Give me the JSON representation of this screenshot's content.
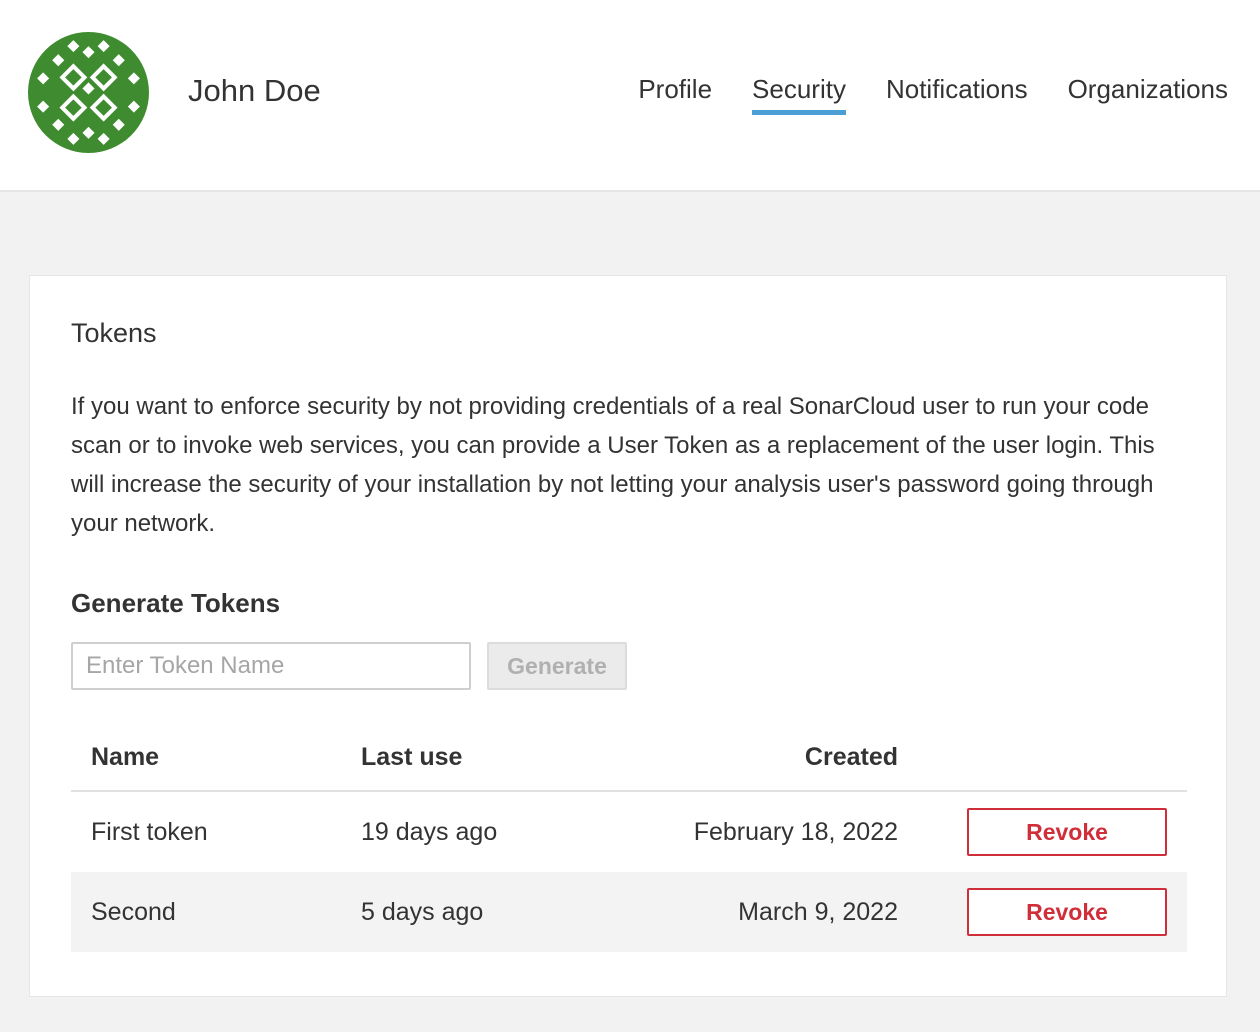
{
  "header": {
    "user_name": "John Doe",
    "avatar_color": "#3e8c2f",
    "active_tab_color": "#4b9fd5",
    "tabs": [
      {
        "label": "Profile"
      },
      {
        "label": "Security",
        "active": true
      },
      {
        "label": "Notifications"
      },
      {
        "label": "Organizations"
      }
    ]
  },
  "tokens": {
    "title": "Tokens",
    "description": "If you want to enforce security by not providing credentials of a real SonarCloud user to run your code scan or to invoke web services, you can provide a User Token as a replacement of the user login. This will increase the security of your installation by not letting your analysis user's password going through your network.",
    "generate_heading": "Generate Tokens",
    "input_placeholder": "Enter Token Name",
    "input_value": "",
    "generate_label": "Generate",
    "columns": {
      "name": "Name",
      "last_use": "Last use",
      "created": "Created"
    },
    "rows": [
      {
        "name": "First token",
        "last_use": "19 days ago",
        "created": "February 18, 2022",
        "action": "Revoke"
      },
      {
        "name": "Second",
        "last_use": "5 days ago",
        "created": "March 9, 2022",
        "action": "Revoke"
      }
    ],
    "revoke_color": "#d02f3a"
  }
}
